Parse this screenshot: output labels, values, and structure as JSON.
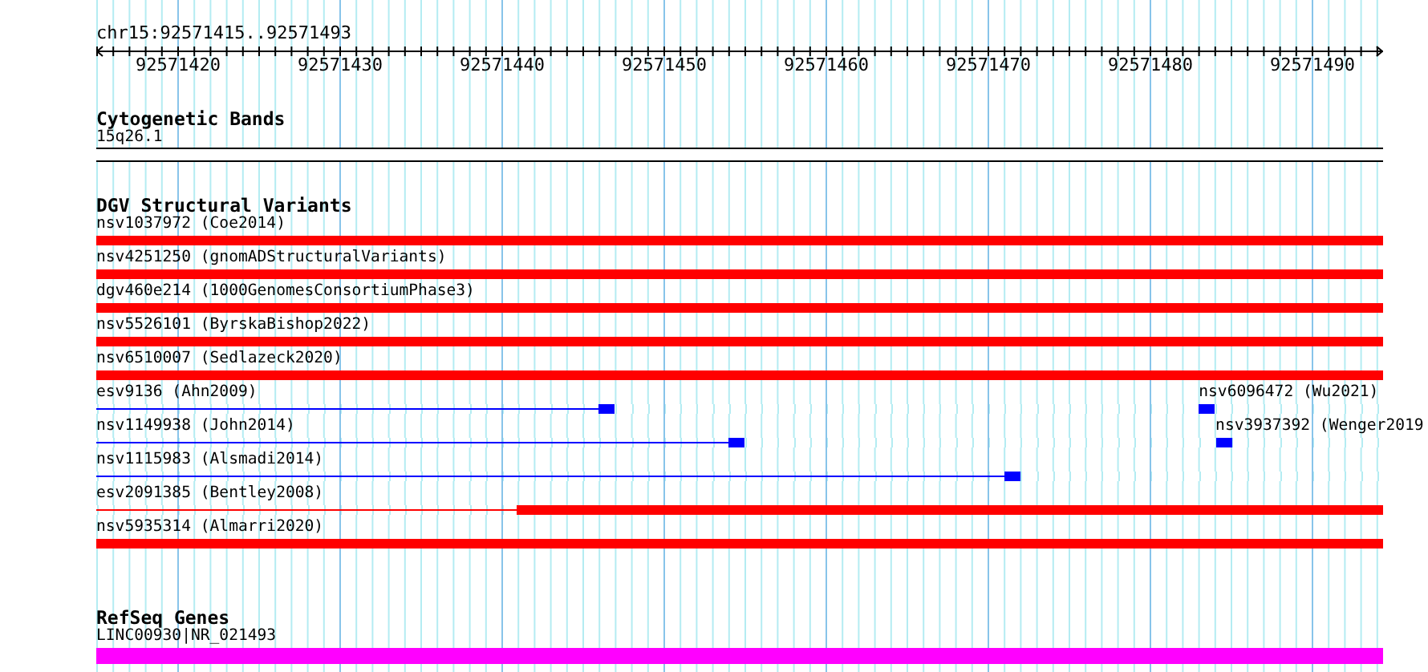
{
  "ruler": {
    "location": "chr15:92571415..92571493",
    "ticks": [
      "92571420",
      "92571430",
      "92571440",
      "92571450",
      "92571460",
      "92571470",
      "92571480",
      "92571490"
    ]
  },
  "tracks": [
    {
      "kind": "cytoband",
      "title": "Cytogenetic Bands",
      "lanes": [
        {
          "features": [
            {
              "label": "15q26.1",
              "bar": {
                "level": 1
              }
            }
          ]
        }
      ]
    },
    {
      "kind": "variants",
      "title": "DGV Structural Variants",
      "lanes": [
        {
          "features": [
            {
              "label": "nsv1037972 (Coe2014)",
              "color": "#ff0000",
              "bar": {
                "level": 1
              }
            }
          ]
        },
        {
          "features": [
            {
              "label": "nsv4251250 (gnomADStructuralVariants)",
              "color": "#ff0000",
              "bar": {
                "level": 1
              }
            }
          ]
        },
        {
          "features": [
            {
              "label": "dgv460e214 (1000GenomesConsortiumPhase3)",
              "color": "#ff0000",
              "bar": {
                "level": 1
              }
            }
          ]
        },
        {
          "features": [
            {
              "label": "nsv5526101 (ByrskaBishop2022)",
              "color": "#ff0000",
              "bar": {
                "level": 1
              }
            }
          ]
        },
        {
          "features": [
            {
              "label": "nsv6510007 (Sedlazeck2020)",
              "color": "#ff0000",
              "bar": {
                "level": 1
              }
            }
          ]
        },
        {
          "features": [
            {
              "label": "esv9136 (Ahn2009)",
              "color": "#0000ff",
              "line": {
                "level": 0.391
              },
              "marker": {
                "level": 0.397
              }
            },
            {
              "label": "nsv6096472 (Wu2021)",
              "color": "#0000ff",
              "marker": {
                "level": 0.863
              }
            }
          ]
        },
        {
          "features": [
            {
              "label": "nsv1149938 (John2014)",
              "color": "#0000ff",
              "line": {
                "level": 0.492
              },
              "marker": {
                "level": 0.498
              }
            },
            {
              "label": "nsv3937392 (Wenger2019",
              "color": "#0000ff",
              "marker": {
                "level": 0.876
              }
            }
          ]
        },
        {
          "features": [
            {
              "label": "nsv1115983 (Alsmadi2014)",
              "color": "#0000ff",
              "line": {
                "level": 0.706
              },
              "marker": {
                "level": 0.712
              }
            }
          ]
        },
        {
          "features": [
            {
              "label": "esv2091385 (Bentley2008)",
              "color": "#ff0000",
              "line": {
                "level": 0.327
              },
              "bar": {
                "level": 0.673
              }
            }
          ]
        },
        {
          "features": [
            {
              "label": "nsv5935314 (Almarri2020)",
              "color": "#ff0000",
              "bar": {
                "level": 1
              }
            }
          ]
        }
      ]
    },
    {
      "kind": "genes",
      "title": "RefSeq Genes",
      "lanes": [
        {
          "features": [
            {
              "label": "LINC00930|NR_021493",
              "color": "#ff00ff",
              "bar": {
                "level": 1
              }
            }
          ]
        }
      ]
    }
  ]
}
